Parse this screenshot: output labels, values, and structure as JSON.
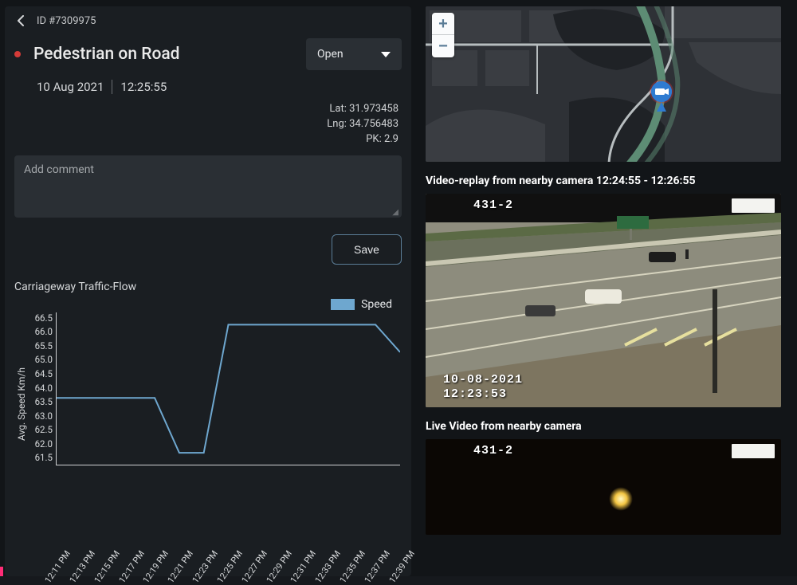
{
  "header": {
    "id_label": "ID #7309975",
    "title": "Pedestrian on Road",
    "status_selected": "Open",
    "date": "10 Aug 2021",
    "time": "12:25:55"
  },
  "coords": {
    "lat_label": "Lat: 31.973458",
    "lng_label": "Lng: 34.756483",
    "pk_label": "PK: 2.9"
  },
  "comment": {
    "placeholder": "Add comment"
  },
  "buttons": {
    "save": "Save"
  },
  "chart_title": "Carriageway Traffic-Flow",
  "legend": {
    "speed": "Speed"
  },
  "ylabel": "Avg. Speed Km/h",
  "right": {
    "replay_label": "Video-replay from nearby camera 12:24:55 - 12:26:55",
    "live_label": "Live Video from nearby camera"
  },
  "video_replay": {
    "camera_id": "431-2",
    "date_overlay": "10-08-2021",
    "time_overlay": "12:23:53"
  },
  "video_live": {
    "camera_id": "431-2"
  },
  "map_controls": {
    "zoom_in": "+",
    "zoom_out": "−"
  },
  "chart_data": {
    "type": "line",
    "title": "Carriageway Traffic-Flow",
    "ylabel": "Avg. Speed Km/h",
    "xlabel": "",
    "ylim": [
      61.5,
      66.5
    ],
    "categories": [
      "12:11 PM",
      "12:13 PM",
      "12:15 PM",
      "12:17 PM",
      "12:19 PM",
      "12:21 PM",
      "12:23 PM",
      "12:25 PM",
      "12:27 PM",
      "12:29 PM",
      "12:31 PM",
      "12:33 PM",
      "12:35 PM",
      "12:37 PM",
      "12:39 PM"
    ],
    "series": [
      {
        "name": "Speed",
        "values": [
          63.7,
          63.7,
          63.7,
          63.7,
          63.7,
          61.9,
          61.9,
          66.1,
          66.1,
          66.1,
          66.1,
          66.1,
          66.1,
          66.1,
          65.2
        ]
      }
    ]
  }
}
